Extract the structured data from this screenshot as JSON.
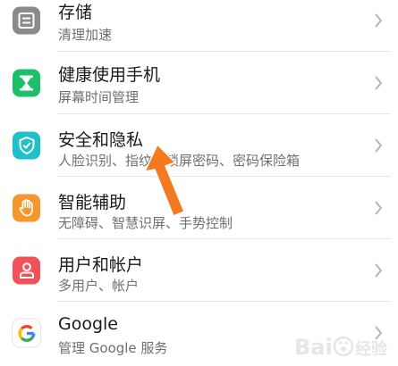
{
  "settings": {
    "items": [
      {
        "title": "存储",
        "subtitle": "清理加速",
        "icon": "storage-icon",
        "color": "#8a8a8a"
      },
      {
        "title": "健康使用手机",
        "subtitle": "屏幕时间管理",
        "icon": "hourglass-icon",
        "color": "#1dbf6a"
      },
      {
        "title": "安全和隐私",
        "subtitle": "人脸识别、指纹、锁屏密码、密码保险箱",
        "icon": "shield-check-icon",
        "color": "#1ec1c8"
      },
      {
        "title": "智能辅助",
        "subtitle": "无障碍、智慧识屏、手势控制",
        "icon": "hand-icon",
        "color": "#f5962f"
      },
      {
        "title": "用户和帐户",
        "subtitle": "多用户、帐户",
        "icon": "user-icon",
        "color": "#f0525a"
      },
      {
        "title": "Google",
        "subtitle": "管理 Google 服务",
        "icon": "google-icon",
        "color": "#ffffff"
      }
    ]
  },
  "annotation": {
    "color": "#f37a1f"
  },
  "watermark": {
    "text": "Bai",
    "suffix": "经验",
    "color": "#b9b9b9"
  }
}
